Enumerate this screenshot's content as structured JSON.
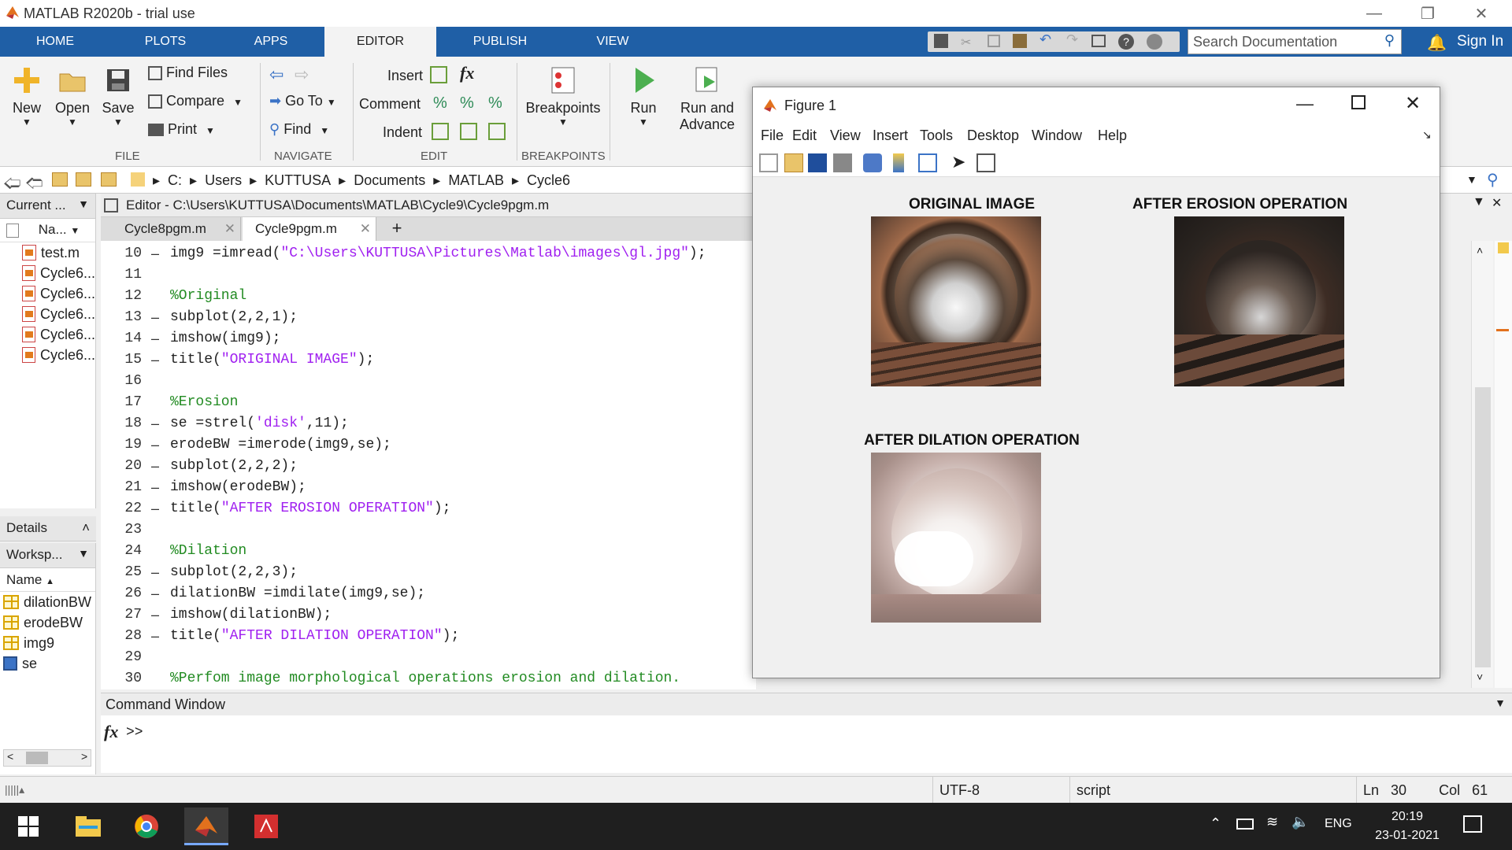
{
  "app": {
    "title": "MATLAB R2020b - trial use"
  },
  "tabs": [
    "HOME",
    "PLOTS",
    "APPS",
    "EDITOR",
    "PUBLISH",
    "VIEW"
  ],
  "search": {
    "placeholder": "Search Documentation"
  },
  "signin": "Sign In",
  "toolstrip": {
    "file": {
      "new": "New",
      "open": "Open",
      "save": "Save",
      "find_files": "Find Files",
      "compare": "Compare",
      "print": "Print",
      "group": "FILE"
    },
    "navigate": {
      "goto": "Go To",
      "find": "Find",
      "group": "NAVIGATE"
    },
    "edit": {
      "insert": "Insert",
      "comment": "Comment",
      "indent": "Indent",
      "group": "EDIT"
    },
    "breakpoints": {
      "label": "Breakpoints",
      "group": "BREAKPOINTS"
    },
    "run": {
      "run": "Run",
      "run_advance_1": "Run and",
      "run_advance_2": "Advance"
    }
  },
  "address": [
    "C:",
    "Users",
    "KUTTUSA",
    "Documents",
    "MATLAB",
    "Cycle6"
  ],
  "current_folder": {
    "header": "Current ...",
    "col_name": "Na...",
    "files": [
      "test.m",
      "Cycle6...",
      "Cycle6...",
      "Cycle6...",
      "Cycle6...",
      "Cycle6..."
    ],
    "details": "Details"
  },
  "workspace": {
    "header": "Worksp...",
    "col_name": "Name",
    "vars": [
      "dilationBW",
      "erodeBW",
      "img9",
      "se"
    ]
  },
  "editor": {
    "header": "Editor - C:\\Users\\KUTTUSA\\Documents\\MATLAB\\Cycle9\\Cycle9pgm.m",
    "tabs": [
      "Cycle8pgm.m",
      "Cycle9pgm.m"
    ],
    "lines": [
      {
        "n": "10",
        "dash": "–",
        "code": "img9 =imread(",
        "str": "\"C:\\Users\\KUTTUSA\\Pictures\\Matlab\\images\\gl.jpg\"",
        "tail": ");",
        "type": "mixed"
      },
      {
        "n": "11",
        "dash": "",
        "code": "",
        "type": "code"
      },
      {
        "n": "12",
        "dash": "",
        "code": "%Original",
        "type": "com"
      },
      {
        "n": "13",
        "dash": "–",
        "code": "subplot(2,2,1);",
        "type": "code"
      },
      {
        "n": "14",
        "dash": "–",
        "code": "imshow(img9);",
        "type": "code"
      },
      {
        "n": "15",
        "dash": "–",
        "code": "title(",
        "str": "\"ORIGINAL IMAGE\"",
        "tail": ");",
        "type": "mixed"
      },
      {
        "n": "16",
        "dash": "",
        "code": "",
        "type": "code"
      },
      {
        "n": "17",
        "dash": "",
        "code": "%Erosion",
        "type": "com"
      },
      {
        "n": "18",
        "dash": "–",
        "code": "se =strel(",
        "str": "'disk'",
        "tail": ",11);",
        "type": "mixed"
      },
      {
        "n": "19",
        "dash": "–",
        "code": "erodeBW =imerode(img9,se);",
        "type": "code"
      },
      {
        "n": "20",
        "dash": "–",
        "code": "subplot(2,2,2);",
        "type": "code"
      },
      {
        "n": "21",
        "dash": "–",
        "code": "imshow(erodeBW);",
        "type": "code"
      },
      {
        "n": "22",
        "dash": "–",
        "code": "title(",
        "str": "\"AFTER EROSION OPERATION\"",
        "tail": ");",
        "type": "mixed"
      },
      {
        "n": "23",
        "dash": "",
        "code": "",
        "type": "code"
      },
      {
        "n": "24",
        "dash": "",
        "code": "%Dilation",
        "type": "com"
      },
      {
        "n": "25",
        "dash": "–",
        "code": "subplot(2,2,3);",
        "type": "code"
      },
      {
        "n": "26",
        "dash": "–",
        "code": "dilationBW =imdilate(img9,se);",
        "type": "code"
      },
      {
        "n": "27",
        "dash": "–",
        "code": "imshow(dilationBW);",
        "type": "code"
      },
      {
        "n": "28",
        "dash": "–",
        "code": "title(",
        "str": "\"AFTER DILATION OPERATION\"",
        "tail": ");",
        "type": "mixed"
      },
      {
        "n": "29",
        "dash": "",
        "code": "",
        "type": "code"
      },
      {
        "n": "30",
        "dash": "",
        "code": "%Perfom image morphological operations erosion and dilation.",
        "type": "com"
      }
    ]
  },
  "command_window": {
    "header": "Command Window",
    "prompt": ">>",
    "fx": "fx"
  },
  "status": {
    "encoding": "UTF-8",
    "type": "script",
    "ln_label": "Ln",
    "ln": "30",
    "col_label": "Col",
    "col": "61"
  },
  "figure": {
    "title": "Figure 1",
    "menu": [
      "File",
      "Edit",
      "View",
      "Insert",
      "Tools",
      "Desktop",
      "Window",
      "Help"
    ],
    "plots": [
      {
        "title": "ORIGINAL IMAGE"
      },
      {
        "title": "AFTER EROSION OPERATION"
      },
      {
        "title": "AFTER DILATION OPERATION"
      }
    ]
  },
  "taskbar": {
    "lang": "ENG",
    "time": "20:19",
    "date": "23-01-2021"
  },
  "colors": {
    "ribbon": "#1f5fa6",
    "string": "#a020f0",
    "comment": "#228b22"
  }
}
